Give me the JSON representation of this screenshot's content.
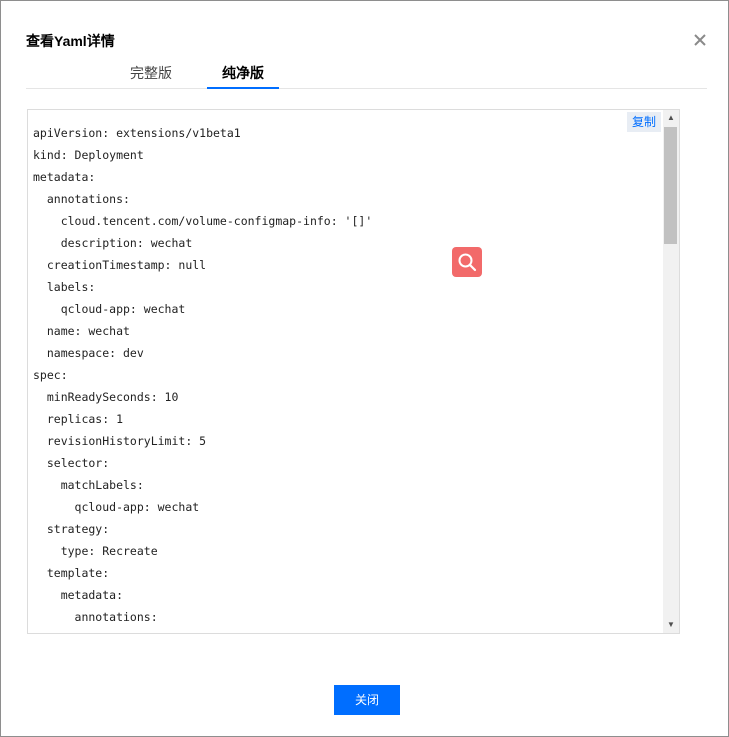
{
  "dialog": {
    "title": "查看Yaml详情",
    "close_icon": "close-icon"
  },
  "tabs": [
    {
      "label": "完整版",
      "active": false
    },
    {
      "label": "纯净版",
      "active": true
    }
  ],
  "code_panel": {
    "copy_label": "复制",
    "lines": [
      "apiVersion: extensions/v1beta1",
      "kind: Deployment",
      "metadata:",
      "  annotations:",
      "    cloud.tencent.com/volume-configmap-info: '[]'",
      "    description: wechat",
      "  creationTimestamp: null",
      "  labels:",
      "    qcloud-app: wechat",
      "  name: wechat",
      "  namespace: dev",
      "spec:",
      "  minReadySeconds: 10",
      "  replicas: 1",
      "  revisionHistoryLimit: 5",
      "  selector:",
      "    matchLabels:",
      "      qcloud-app: wechat",
      "  strategy:",
      "    type: Recreate",
      "  template:",
      "    metadata:",
      "      annotations:"
    ]
  },
  "footer": {
    "close_label": "关闭"
  },
  "colors": {
    "accent": "#006eff",
    "search_float": "#f26a6a"
  }
}
